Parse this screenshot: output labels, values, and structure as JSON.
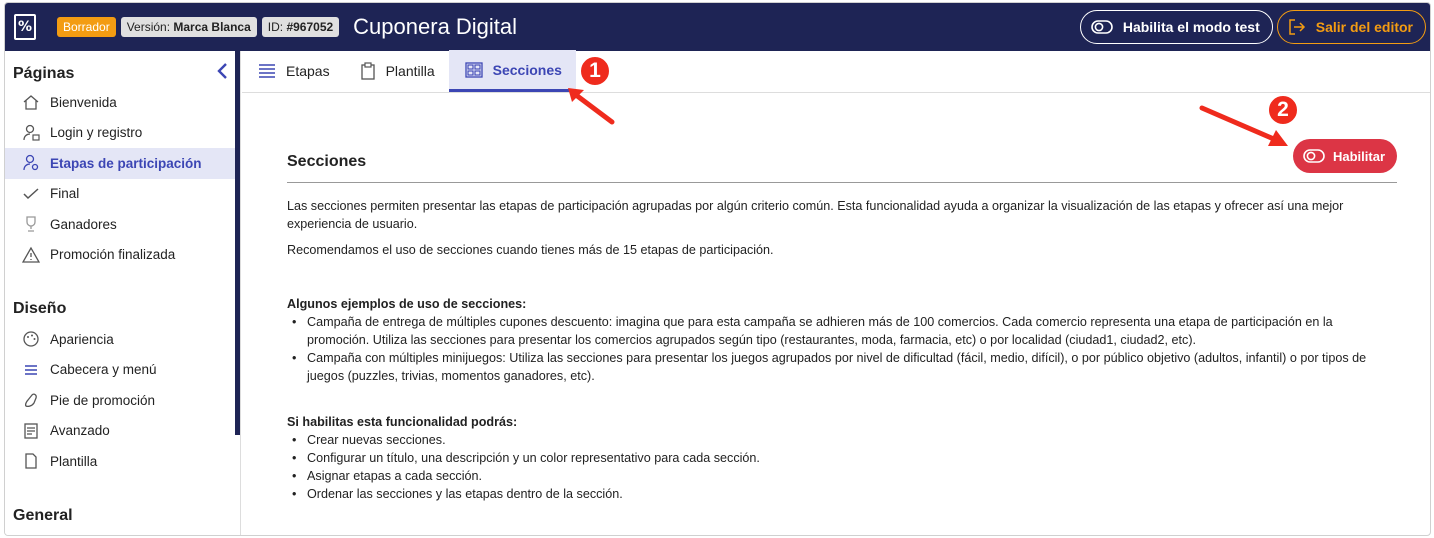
{
  "topbar": {
    "badge_draft": "Borrador",
    "version_label": "Versión:",
    "version_value": "Marca Blanca",
    "id_label": "ID:",
    "id_value": "#967052",
    "title": "Cuponera Digital",
    "test_mode_button": "Habilita el modo test",
    "exit_button": "Salir del editor",
    "colors": {
      "bar": "#1e2455",
      "accent": "#f39c12"
    }
  },
  "sidebar": {
    "pages_title": "Páginas",
    "pages_items": [
      {
        "label": "Bienvenida",
        "icon": "home-icon"
      },
      {
        "label": "Login y registro",
        "icon": "user-lock-icon"
      },
      {
        "label": "Etapas de participación",
        "icon": "user-search-icon",
        "active": true
      },
      {
        "label": "Final",
        "icon": "check-icon"
      },
      {
        "label": "Ganadores",
        "icon": "trophy-icon"
      },
      {
        "label": "Promoción finalizada",
        "icon": "warning-icon"
      }
    ],
    "design_title": "Diseño",
    "design_items": [
      {
        "label": "Apariencia",
        "icon": "palette-icon"
      },
      {
        "label": "Cabecera y menú",
        "icon": "menu-icon"
      },
      {
        "label": "Pie de promoción",
        "icon": "foot-icon"
      },
      {
        "label": "Avanzado",
        "icon": "document-settings-icon"
      },
      {
        "label": "Plantilla",
        "icon": "file-icon"
      }
    ],
    "general_title": "General"
  },
  "tabs": [
    {
      "label": "Etapas",
      "icon": "list-icon"
    },
    {
      "label": "Plantilla",
      "icon": "clipboard-icon"
    },
    {
      "label": "Secciones",
      "icon": "grid-icon",
      "active": true
    }
  ],
  "content": {
    "title": "Secciones",
    "enable_button": "Habilitar",
    "intro_p1": "Las secciones permiten presentar las etapas de participación agrupadas por algún criterio común. Esta funcionalidad ayuda a organizar la visualización de las etapas y ofrecer así una mejor experiencia de usuario.",
    "intro_p2": "Recomendamos el uso de secciones cuando tienes más de 15 etapas de participación.",
    "examples_title": "Algunos ejemplos de uso de secciones:",
    "examples": [
      "Campaña de entrega de múltiples cupones descuento: imagina que para esta campaña se adhieren más de 100 comercios. Cada comercio representa una etapa de participación en la promoción. Utiliza las secciones para presentar los comercios agrupados según tipo (restaurantes, moda, farmacia, etc) o por localidad (ciudad1, ciudad2, etc).",
      "Campaña con múltiples minijuegos: Utiliza las secciones para presentar los juegos agrupados por nivel de dificultad (fácil, medio, difícil), o por público objetivo (adultos, infantil) o por tipos de juegos (puzzles, trivias, momentos ganadores, etc)."
    ],
    "benefits_title": "Si habilitas esta funcionalidad podrás:",
    "benefits": [
      "Crear nuevas secciones.",
      "Configurar un título, una descripción y un color representativo para cada sección.",
      "Asignar etapas a cada sección.",
      "Ordenar las secciones y las etapas dentro de la sección."
    ],
    "enable_color": "#dc3545",
    "active_color": "#3c46b4"
  },
  "annotations": {
    "marker_1": "1",
    "marker_2": "2",
    "color": "#ef2b1d"
  }
}
